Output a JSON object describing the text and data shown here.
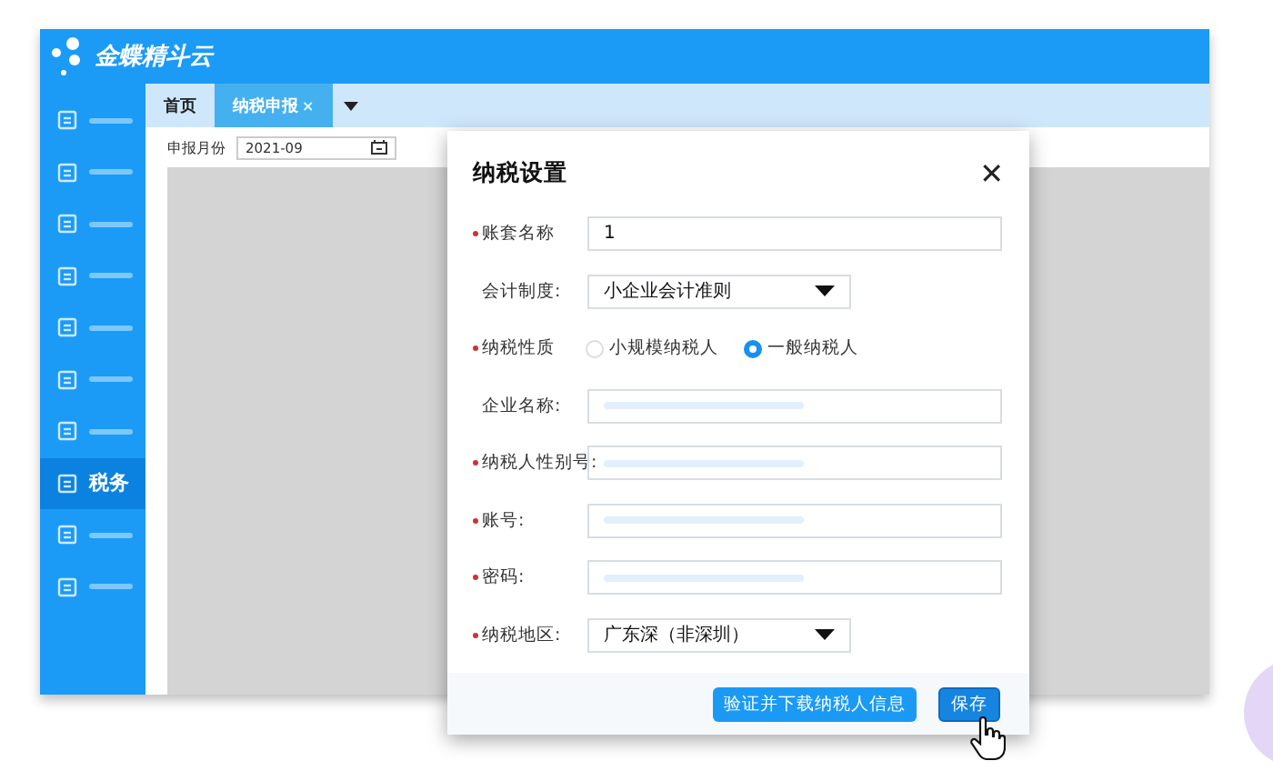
{
  "header": {
    "logo_text": "金蝶精斗云"
  },
  "sidebar": {
    "items": [
      {
        "selected": false
      },
      {
        "selected": false
      },
      {
        "selected": false
      },
      {
        "selected": false
      },
      {
        "selected": false
      },
      {
        "selected": false
      },
      {
        "selected": false
      },
      {
        "label": "税务",
        "selected": true
      },
      {
        "selected": false
      },
      {
        "selected": false
      }
    ]
  },
  "tabs": [
    {
      "label": "首页",
      "selected": false,
      "closable": false
    },
    {
      "label": "纳税申报",
      "selected": true,
      "closable": true,
      "close_glyph": "×"
    }
  ],
  "filter": {
    "label": "申报月份",
    "value": "2021-09"
  },
  "dialog": {
    "title": "纳税设置",
    "close_glyph": "✕",
    "fields": [
      {
        "kind": "text",
        "label": "账套名称",
        "required": true,
        "value": "1"
      },
      {
        "kind": "select",
        "label": "会计制度:",
        "required": false,
        "value": "小企业会计准则"
      },
      {
        "kind": "radio",
        "label": "纳税性质",
        "required": true,
        "options": [
          {
            "label": "小规模纳税人",
            "selected": false
          },
          {
            "label": "一般纳税人",
            "selected": true
          }
        ]
      },
      {
        "kind": "redacted",
        "label": "企业名称:",
        "required": false
      },
      {
        "kind": "redacted",
        "label": "纳税人性别号:",
        "required": true
      },
      {
        "kind": "redacted",
        "label": "账号:",
        "required": true
      },
      {
        "kind": "redacted",
        "label": "密码:",
        "required": true
      },
      {
        "kind": "select",
        "label": "纳税地区:",
        "required": true,
        "value": "广东深（非深圳）"
      }
    ],
    "buttons": [
      {
        "label": "验证并下载纳税人信息"
      },
      {
        "label": "保存"
      }
    ]
  }
}
